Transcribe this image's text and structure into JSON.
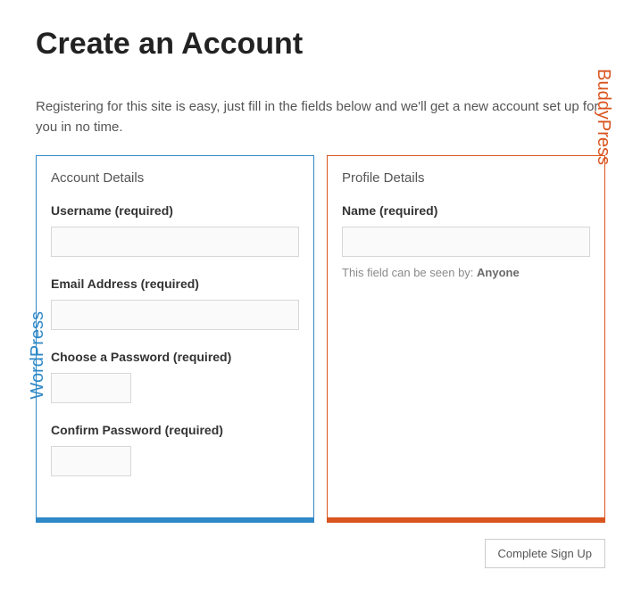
{
  "title": "Create an Account",
  "intro": "Registering for this site is easy, just fill in the fields below and we'll get a new account set up for you in no time.",
  "left": {
    "brand": "WordPress",
    "section": "Account Details",
    "username_label": "Username (required)",
    "email_label": "Email Address (required)",
    "password_label": "Choose a Password (required)",
    "confirm_label": "Confirm Password (required)"
  },
  "right": {
    "brand": "BuddyPress",
    "section": "Profile Details",
    "name_label": "Name (required)",
    "visibility_prefix": "This field can be seen by: ",
    "visibility_value": "Anyone"
  },
  "submit_label": "Complete Sign Up"
}
